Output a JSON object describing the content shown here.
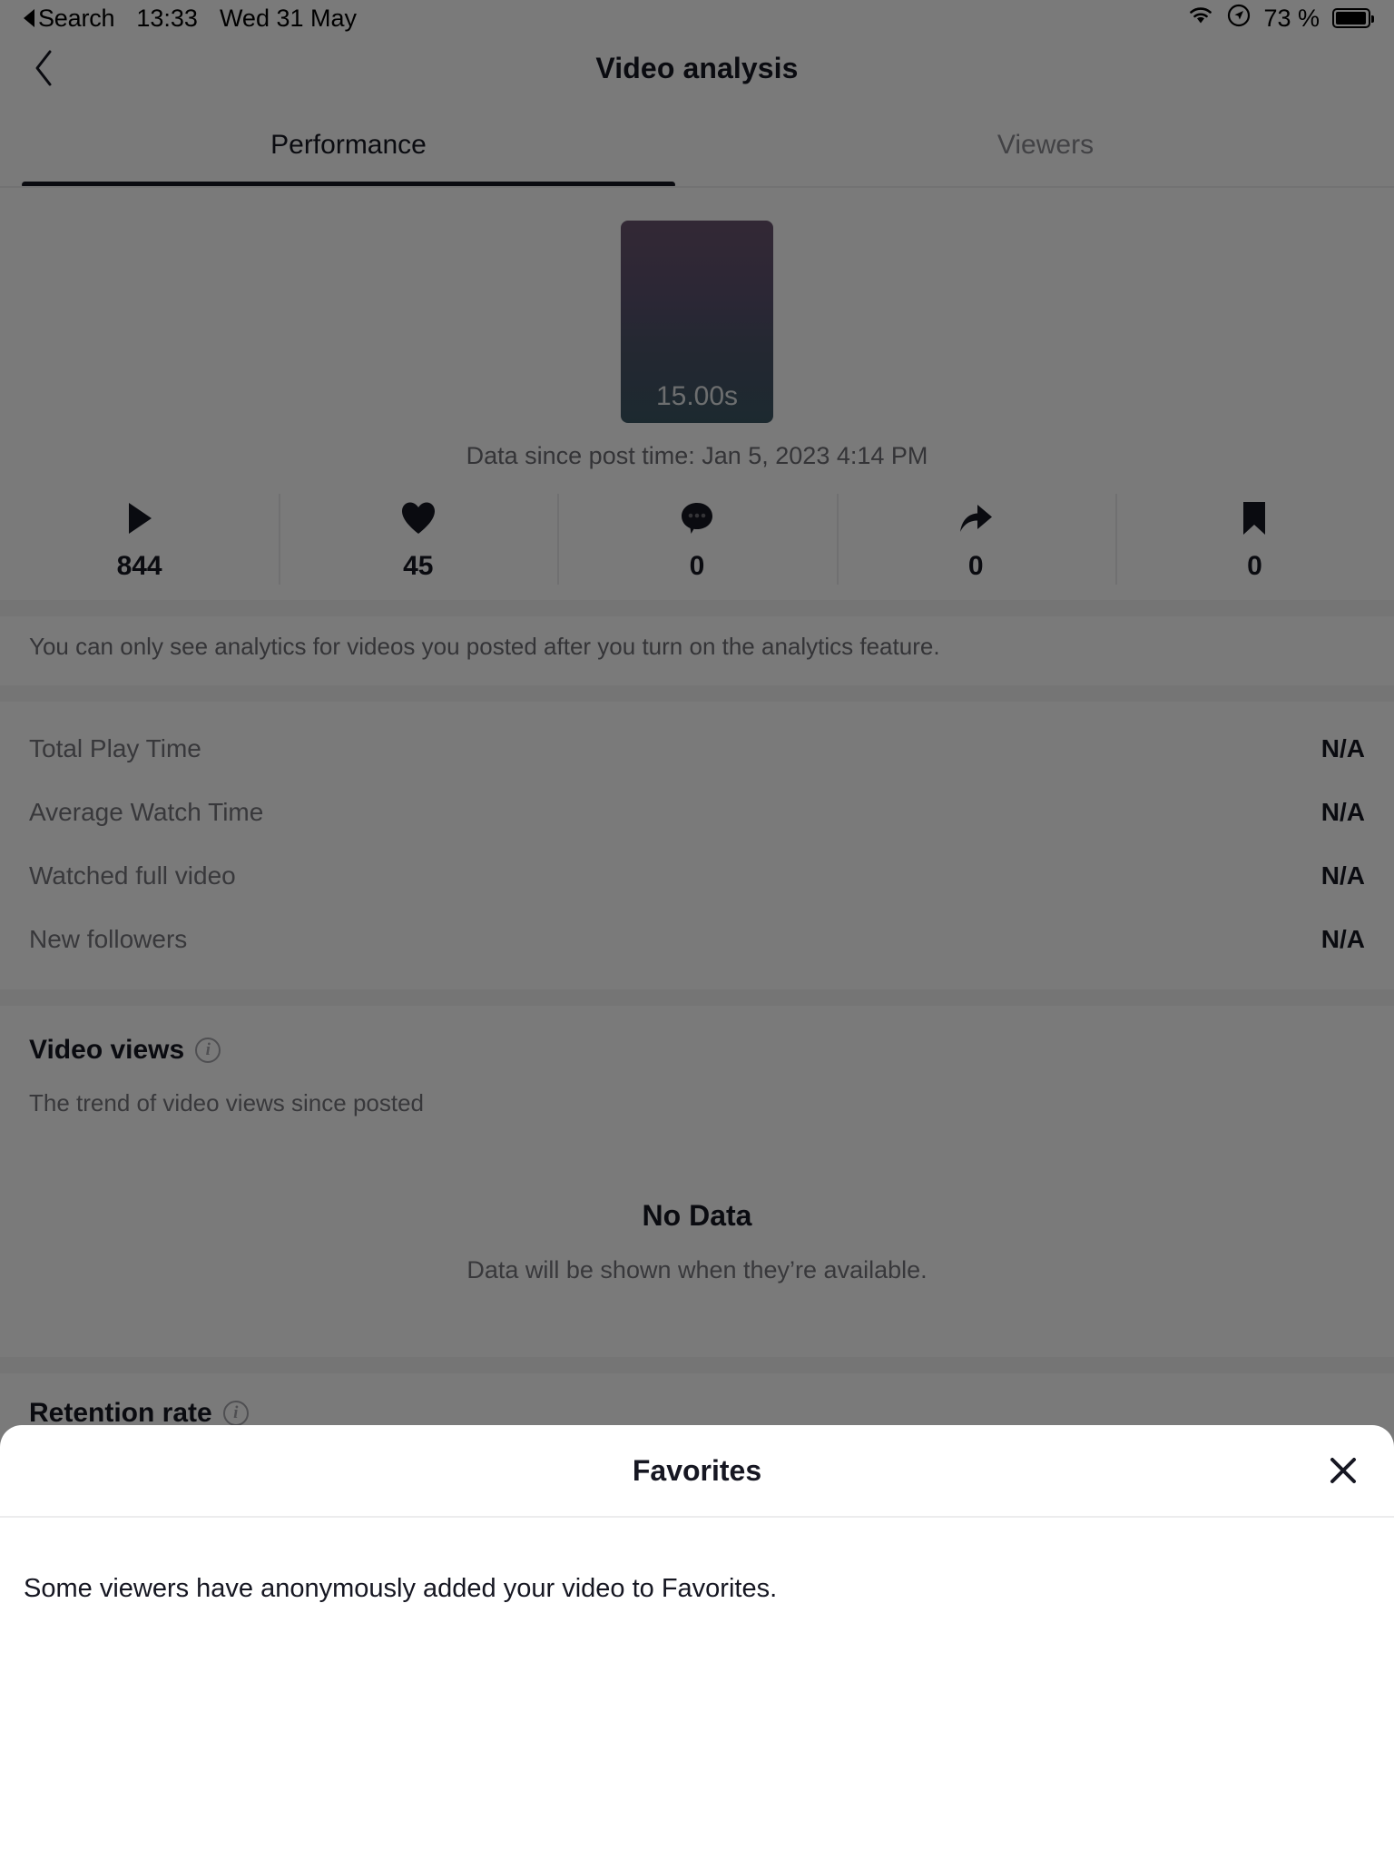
{
  "status_bar": {
    "back_app": "Search",
    "time": "13:33",
    "date": "Wed 31 May",
    "battery_percent": "73 %",
    "wifi_icon": "wifi-icon",
    "location_icon": "location-icon",
    "battery_icon": "battery-icon"
  },
  "nav": {
    "back_icon": "chevron-left-icon",
    "title": "Video analysis"
  },
  "tabs": [
    {
      "label": "Performance",
      "active": true
    },
    {
      "label": "Viewers",
      "active": false
    }
  ],
  "video": {
    "duration": "15.00s",
    "data_since": "Data since post time: Jan 5, 2023 4:14 PM",
    "thumb_gradient_top": "#6b5570",
    "thumb_gradient_bottom": "#3c5663"
  },
  "stats": [
    {
      "icon": "play-icon",
      "value": "844"
    },
    {
      "icon": "heart-icon",
      "value": "45"
    },
    {
      "icon": "comment-icon",
      "value": "0"
    },
    {
      "icon": "share-icon",
      "value": "0"
    },
    {
      "icon": "bookmark-icon",
      "value": "0"
    }
  ],
  "notice": "You can only see analytics for videos you posted after you turn on the analytics feature.",
  "metrics": [
    {
      "label": "Total Play Time",
      "value": "N/A"
    },
    {
      "label": "Average Watch Time",
      "value": "N/A"
    },
    {
      "label": "Watched full video",
      "value": "N/A"
    },
    {
      "label": "New followers",
      "value": "N/A"
    }
  ],
  "video_views": {
    "title": "Video views",
    "info_icon": "info-icon",
    "subtitle": "The trend of video views since posted",
    "no_data_title": "No Data",
    "no_data_sub": "Data will be shown when they’re available."
  },
  "retention": {
    "title": "Retention rate",
    "info_icon": "info-icon"
  },
  "sheet": {
    "title": "Favorites",
    "close_icon": "close-icon",
    "body": "Some viewers have anonymously added your video to Favorites."
  }
}
